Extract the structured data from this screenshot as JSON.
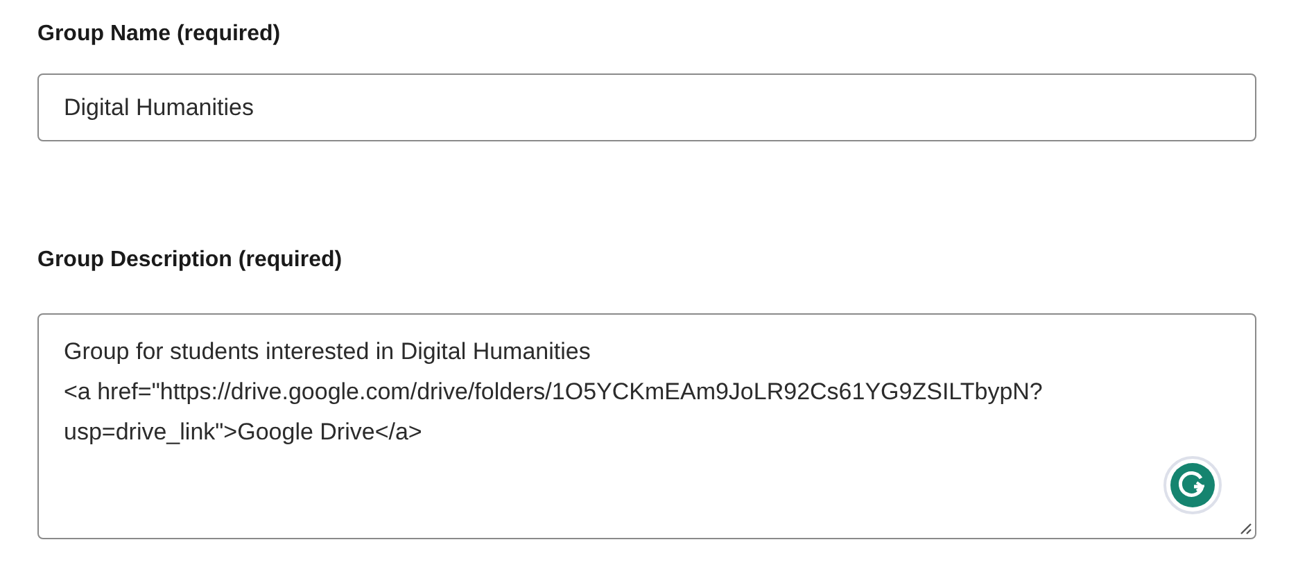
{
  "fields": [
    {
      "kind": "input",
      "label": "Group Name (required)",
      "value": "Digital Humanities"
    },
    {
      "kind": "textarea",
      "label": "Group Description (required)",
      "lines": [
        "Group for students interested in Digital Humanities",
        "<a href=\"https://drive.google.com/drive/folders/1O5YCKmEAm9JoLR92Cs61YG9ZSILTbypN?",
        "usp=drive_link\">Google Drive</a>"
      ]
    }
  ]
}
